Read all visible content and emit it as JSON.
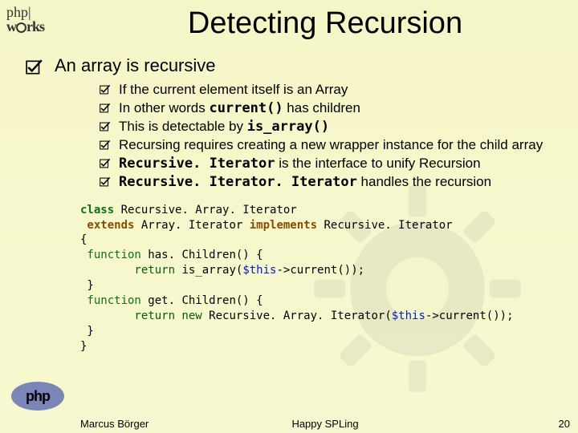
{
  "logo": {
    "top_line1": "php",
    "top_bar": "|",
    "top_line2_prefix": "w",
    "top_line2_suffix": "rks",
    "bottom": "php"
  },
  "title": "Detecting Recursion",
  "main_point": "An array is recursive",
  "subs": [
    {
      "plain": "If the current element itself is an Array"
    },
    {
      "pre": "In other words ",
      "mono": "current()",
      "post": " has children"
    },
    {
      "pre": "This is detectable by ",
      "mono": "is_array()"
    },
    {
      "plain": "Recursing requires creating a new wrapper instance for the child array"
    },
    {
      "bold": "Recursive. Iterator",
      "post": " is the interface to unify Recursion"
    },
    {
      "bold": "Recursive. Iterator. Iterator",
      "post": " handles the recursion"
    }
  ],
  "code": {
    "l1a": "class",
    "l1b": " Recursive. Array. Iterator",
    "l2a": " extends",
    "l2b": " Array. Iterator ",
    "l2c": "implements",
    "l2d": " Recursive. Iterator",
    "l3": "{",
    "l4a": " function ",
    "l4b": "has. Children",
    "l4c": "() {",
    "l5a": "        return ",
    "l5b": "is_array",
    "l5c": "(",
    "l5d": "$this",
    "l5e": "->",
    "l5f": "current",
    "l5g": "());",
    "l6": " }",
    "l7a": " function ",
    "l7b": "get. Children",
    "l7c": "() {",
    "l8a": "        return new ",
    "l8b": "Recursive. Array. Iterator",
    "l8c": "(",
    "l8d": "$this",
    "l8e": "->",
    "l8f": "current",
    "l8g": "());",
    "l9": " }",
    "l10": "}"
  },
  "footer": {
    "author": "Marcus Börger",
    "talk": "Happy SPLing",
    "page": "20"
  }
}
